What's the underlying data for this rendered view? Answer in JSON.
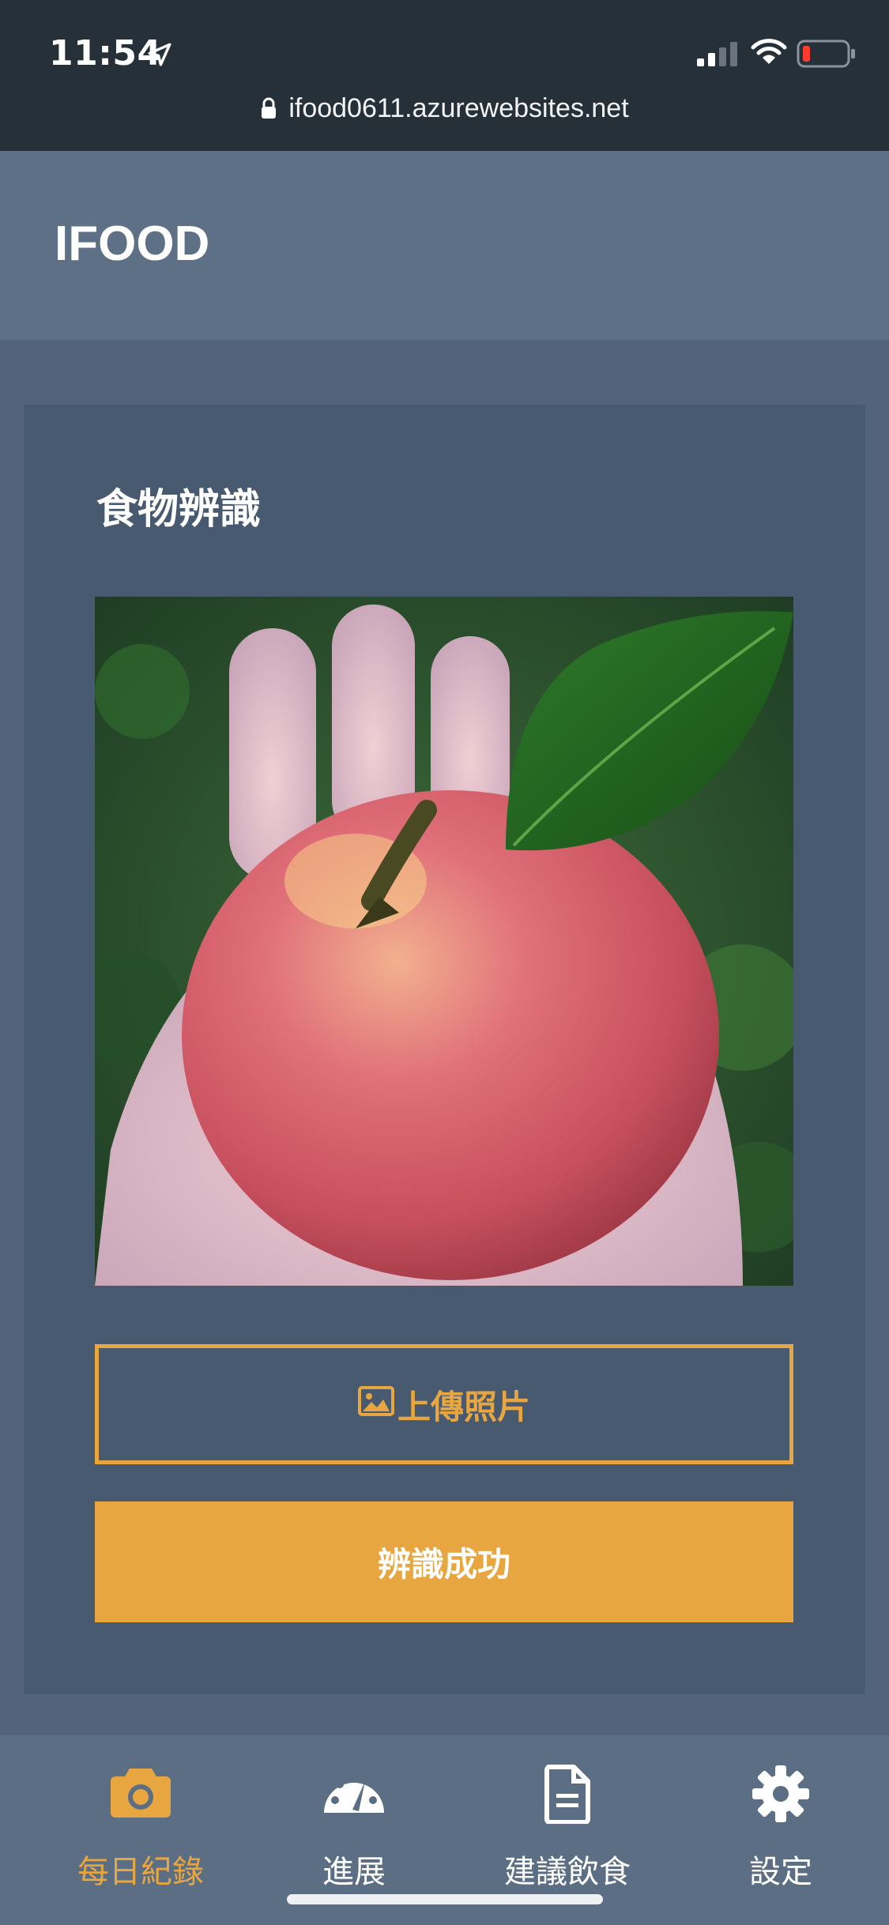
{
  "status": {
    "time": "11:54",
    "url": "ifood0611.azurewebsites.net"
  },
  "header": {
    "brand": "IFOOD"
  },
  "card": {
    "title": "食物辨識",
    "photo_alt": "apple",
    "upload_label": "上傳照片",
    "result_label": "辨識成功"
  },
  "tabs": [
    {
      "label": "每日紀錄",
      "icon": "camera-icon",
      "active": true
    },
    {
      "label": "進展",
      "icon": "dashboard-icon",
      "active": false
    },
    {
      "label": "建議飲食",
      "icon": "document-icon",
      "active": false
    },
    {
      "label": "設定",
      "icon": "gear-icon",
      "active": false
    }
  ],
  "colors": {
    "accent": "#e8a640",
    "background": "#53647a",
    "card": "#475a70",
    "header": "#5d7085",
    "statusbar": "#263039"
  }
}
